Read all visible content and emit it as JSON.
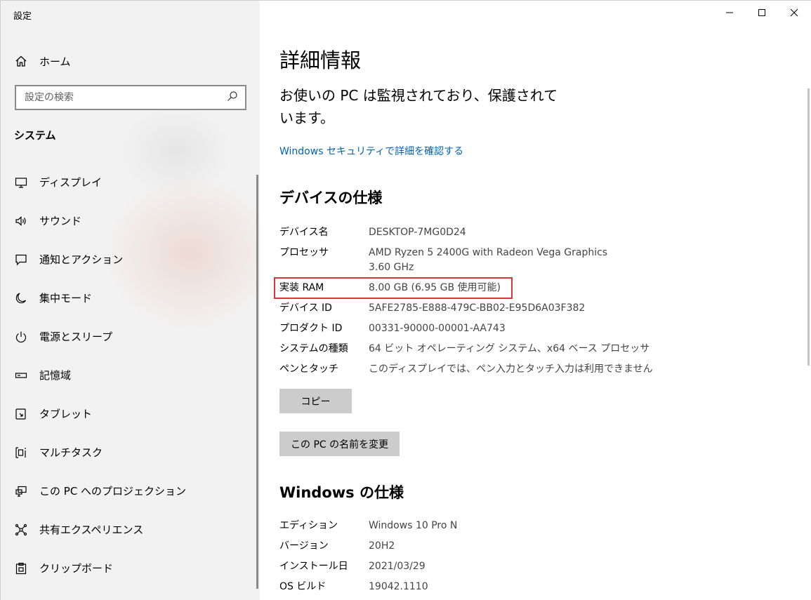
{
  "window": {
    "title": "設定"
  },
  "sidebar": {
    "home_label": "ホーム",
    "search_placeholder": "設定の検索",
    "section_title": "システム",
    "items": [
      {
        "label": "ディスプレイ",
        "icon": "monitor-icon"
      },
      {
        "label": "サウンド",
        "icon": "speaker-icon"
      },
      {
        "label": "通知とアクション",
        "icon": "notification-icon"
      },
      {
        "label": "集中モード",
        "icon": "moon-icon"
      },
      {
        "label": "電源とスリープ",
        "icon": "power-icon"
      },
      {
        "label": "記憶域",
        "icon": "storage-icon"
      },
      {
        "label": "タブレット",
        "icon": "tablet-icon"
      },
      {
        "label": "マルチタスク",
        "icon": "multitask-icon"
      },
      {
        "label": "この PC へのプロジェクション",
        "icon": "projection-icon"
      },
      {
        "label": "共有エクスペリエンス",
        "icon": "shared-experience-icon"
      },
      {
        "label": "クリップボード",
        "icon": "clipboard-icon"
      }
    ]
  },
  "main": {
    "title": "詳細情報",
    "status_text": "お使いの PC は監視されており、保護されています。",
    "security_link": "Windows セキュリティで詳細を確認する",
    "device_specs": {
      "heading": "デバイスの仕様",
      "rows": [
        {
          "key": "デバイス名",
          "value": "DESKTOP-7MG0D24"
        },
        {
          "key": "プロセッサ",
          "value": "AMD Ryzen 5 2400G with Radeon Vega Graphics",
          "value2": "3.60 GHz"
        },
        {
          "key": "実装 RAM",
          "value": "8.00 GB (6.95 GB 使用可能)"
        },
        {
          "key": "デバイス ID",
          "value": "5AFE2785-E888-479C-BB02-E95D6A03F382"
        },
        {
          "key": "プロダクト ID",
          "value": "00331-90000-00001-AA743"
        },
        {
          "key": "システムの種類",
          "value": "64 ビット オペレーティング システム、x64 ベース プロセッサ"
        },
        {
          "key": "ペンとタッチ",
          "value": "このディスプレイでは、ペン入力とタッチ入力は利用できません"
        }
      ],
      "copy_button": "コピー",
      "rename_button": "この PC の名前を変更"
    },
    "windows_specs": {
      "heading": "Windows の仕様",
      "rows": [
        {
          "key": "エディション",
          "value": "Windows 10 Pro N"
        },
        {
          "key": "バージョン",
          "value": "20H2"
        },
        {
          "key": "インストール日",
          "value": "2021/03/29"
        },
        {
          "key": "OS ビルド",
          "value": "19042.1110"
        }
      ]
    }
  },
  "colors": {
    "link": "#0063b1",
    "highlight": "#d23a3a",
    "sidebar_bg": "#f2f2f2",
    "button_bg": "#cccccc"
  }
}
